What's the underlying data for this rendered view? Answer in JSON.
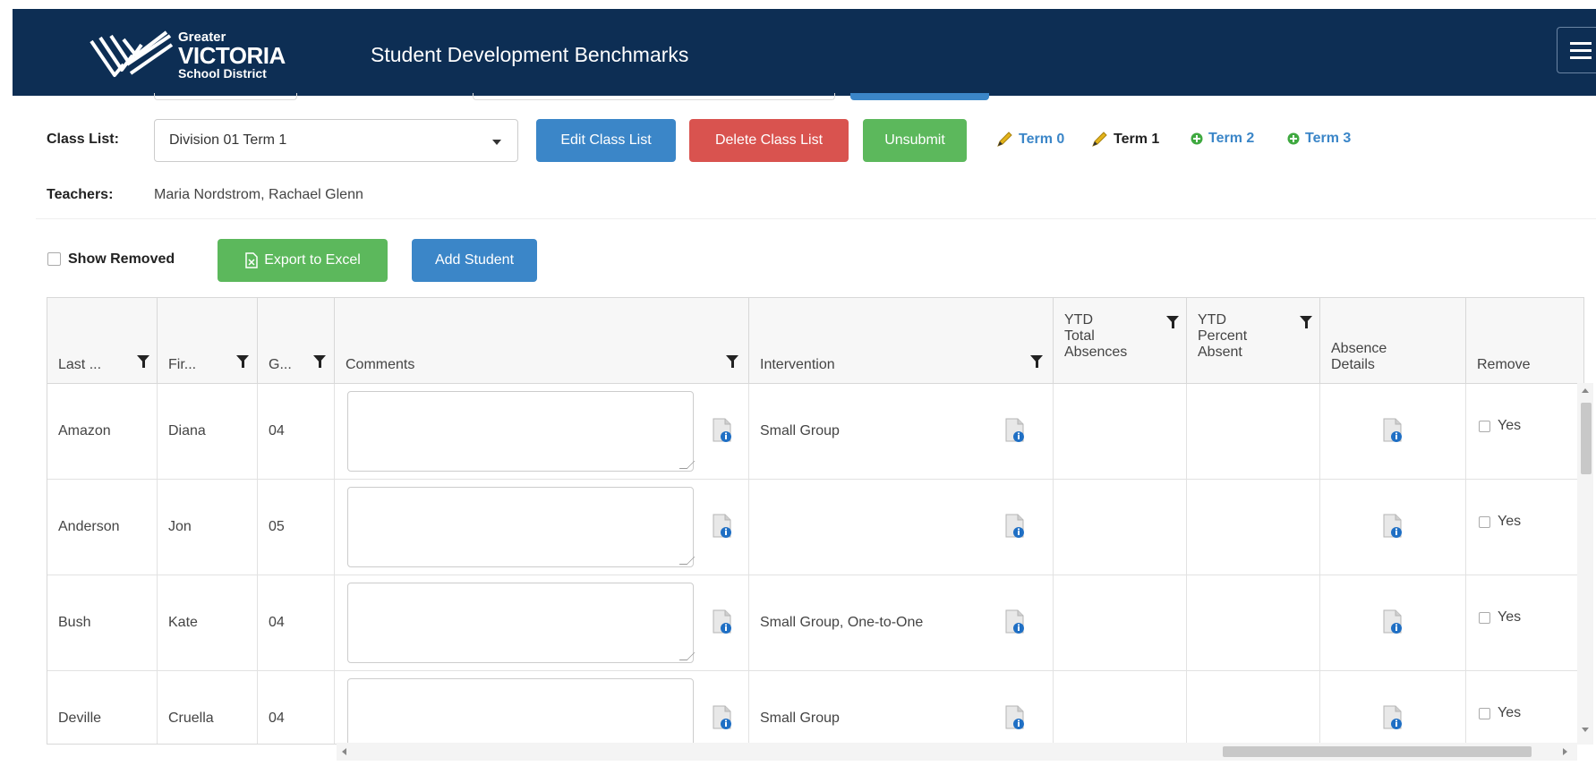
{
  "header": {
    "logo": {
      "line1": "Greater",
      "line2": "VICTORIA",
      "line3": "School District"
    },
    "title": "Student Development Benchmarks",
    "bg_color": "#0d2e54"
  },
  "class_list": {
    "label": "Class List:",
    "selected": "Division 01 Term 1",
    "edit_label": "Edit Class List",
    "delete_label": "Delete Class List",
    "unsubmit_label": "Unsubmit"
  },
  "terms": [
    {
      "label": "Term 0",
      "icon": "pencil-icon"
    },
    {
      "label": "Term 1",
      "icon": "pencil-icon"
    },
    {
      "label": "Term 2",
      "icon": "plus-icon"
    },
    {
      "label": "Term 3",
      "icon": "plus-icon"
    }
  ],
  "teachers": {
    "label": "Teachers:",
    "value": "Maria Nordstrom, Rachael Glenn"
  },
  "toolbar": {
    "show_removed": "Show Removed",
    "export_label": "Export to Excel",
    "add_student_label": "Add Student"
  },
  "grid": {
    "columns": {
      "last": "Last ...",
      "first": "Fir...",
      "grade": "G...",
      "comments": "Comments",
      "intervention": "Intervention",
      "ytd_total_1": "YTD",
      "ytd_total_2": "Total",
      "ytd_total_3": "Absences",
      "ytd_pct_1": "YTD",
      "ytd_pct_2": "Percent",
      "ytd_pct_3": "Absent",
      "absence_1": "Absence",
      "absence_2": "Details",
      "remove": "Remove"
    },
    "rows": [
      {
        "last": "Amazon",
        "first": "Diana",
        "grade": "04",
        "intervention": "Small Group",
        "remove": "Yes"
      },
      {
        "last": "Anderson",
        "first": "Jon",
        "grade": "05",
        "intervention": "",
        "remove": "Yes"
      },
      {
        "last": "Bush",
        "first": "Kate",
        "grade": "04",
        "intervention": "Small Group, One-to-One",
        "remove": "Yes"
      },
      {
        "last": "Deville",
        "first": "Cruella",
        "grade": "04",
        "intervention": "Small Group",
        "remove": "Yes"
      }
    ]
  },
  "colors": {
    "primary": "#3b86c8",
    "danger": "#d9534f",
    "success": "#5cb85c",
    "term_plus": "#3fa940",
    "pencil": "#e3b31a"
  }
}
